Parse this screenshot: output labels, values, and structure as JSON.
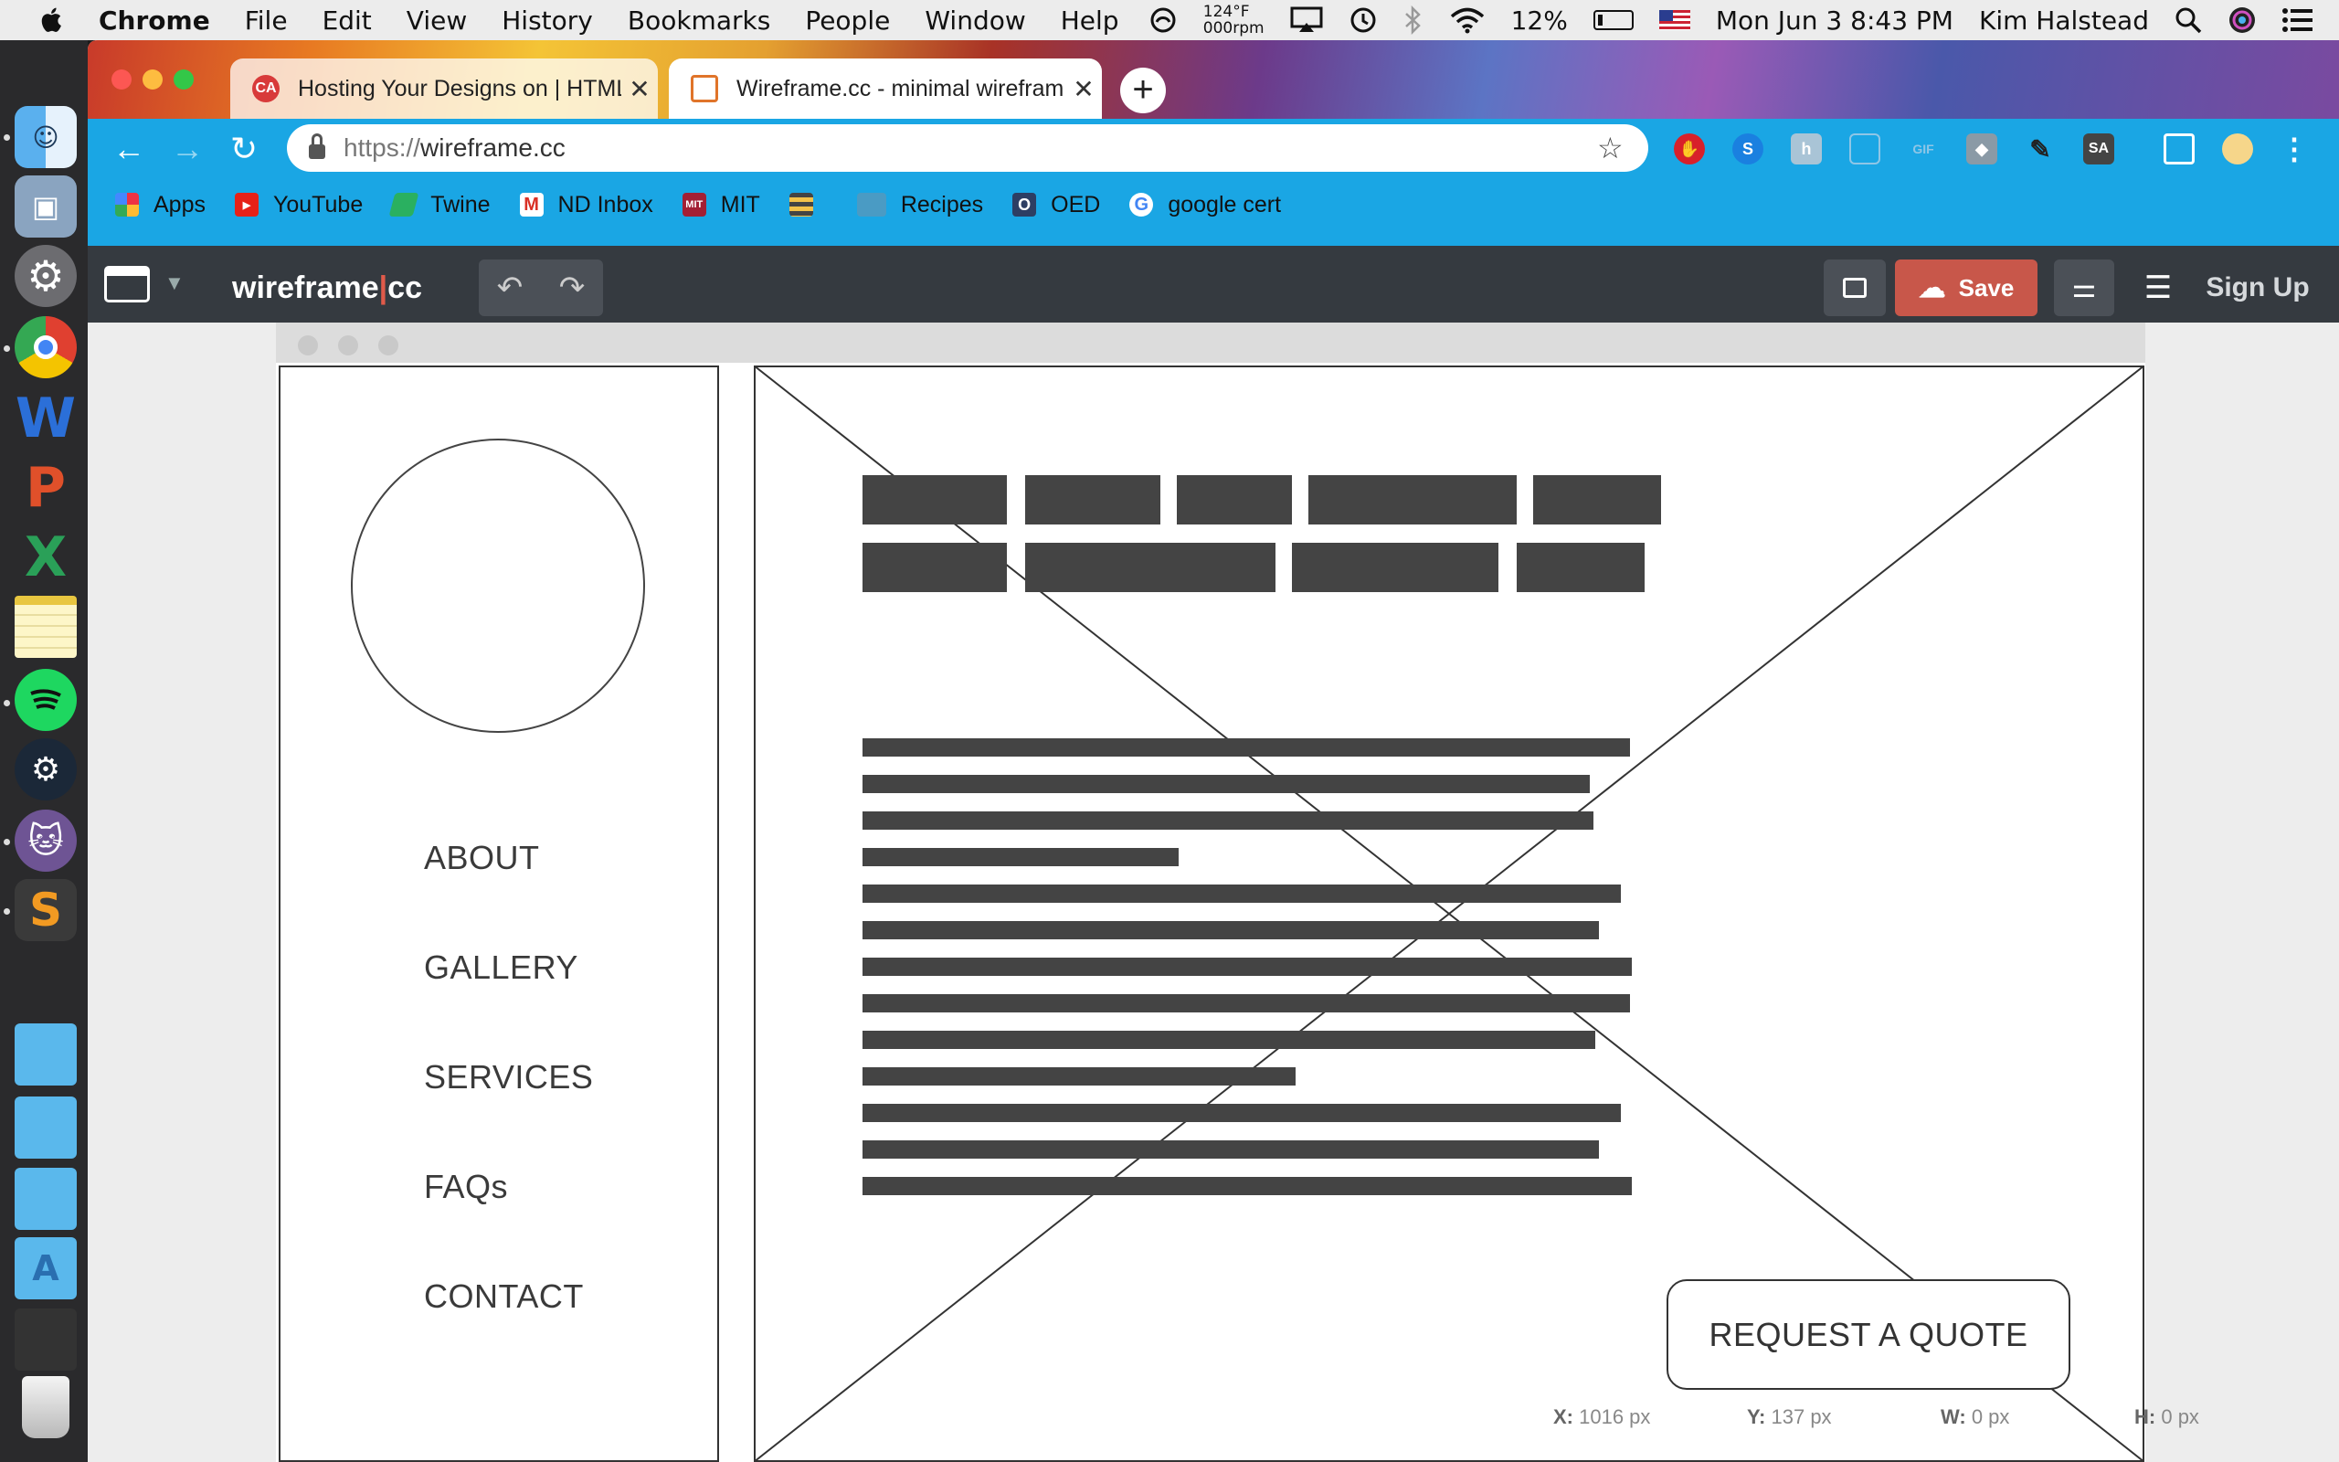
{
  "menubar": {
    "app_name": "Chrome",
    "menus": [
      "File",
      "Edit",
      "View",
      "History",
      "Bookmarks",
      "People",
      "Window",
      "Help"
    ],
    "temperature": "124°F",
    "fan": "000rpm",
    "battery": "12%",
    "datetime": "Mon Jun 3  8:43 PM",
    "user": "Kim Halstead"
  },
  "tabs": [
    {
      "title": "Hosting Your Designs on | HTML",
      "active": false
    },
    {
      "title": "Wireframe.cc - minimal wireframing",
      "active": true
    }
  ],
  "address_bar": {
    "scheme": "https://",
    "host": "wireframe.cc"
  },
  "extensions": [
    "adblock",
    "s",
    "hangouts",
    "doc",
    "gif",
    "cube",
    "eyedropper",
    "sa",
    "cast",
    "profile"
  ],
  "bookmarks": [
    {
      "label": "Apps",
      "icon": "apps-grid-icon"
    },
    {
      "label": "YouTube",
      "icon": "youtube-icon"
    },
    {
      "label": "Twine",
      "icon": "twine-icon"
    },
    {
      "label": "ND Inbox",
      "icon": "gmail-icon"
    },
    {
      "label": "MIT",
      "icon": "mit-ocw-icon"
    },
    {
      "label": "",
      "icon": "stack-icon"
    },
    {
      "label": "Recipes",
      "icon": "folder-icon"
    },
    {
      "label": "OED",
      "icon": "oed-icon"
    },
    {
      "label": "google cert",
      "icon": "google-icon"
    }
  ],
  "app": {
    "logo_left": "wireframe",
    "logo_sep": "|",
    "logo_right": "cc",
    "save_label": "Save",
    "signup_label": "Sign Up",
    "accent": "#c8574a"
  },
  "wireframe": {
    "nav": [
      "ABOUT",
      "GALLERY",
      "SERVICES",
      "FAQs",
      "CONTACT"
    ],
    "cta": "REQUEST A QUOTE"
  },
  "status": {
    "x_label": "X:",
    "x_value": "1016 px",
    "y_label": "Y:",
    "y_value": "137 px",
    "w_label": "W:",
    "w_value": "0 px",
    "h_label": "H:",
    "h_value": "0 px"
  }
}
